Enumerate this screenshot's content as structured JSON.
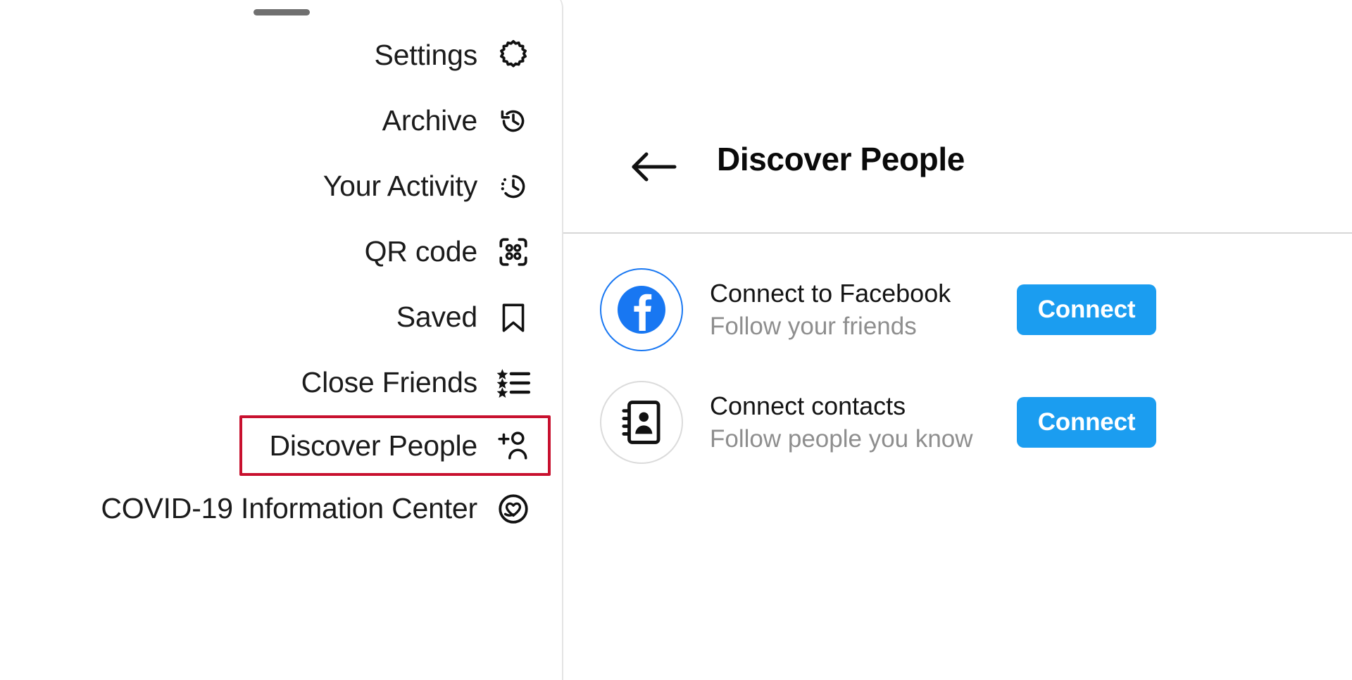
{
  "sheet": {
    "drag_handle": "drag-handle",
    "menu_items": [
      {
        "label": "Settings",
        "icon": "gear-icon",
        "highlighted": false
      },
      {
        "label": "Archive",
        "icon": "archive-clock-icon",
        "highlighted": false
      },
      {
        "label": "Your Activity",
        "icon": "activity-clock-icon",
        "highlighted": false
      },
      {
        "label": "QR code",
        "icon": "qr-code-icon",
        "highlighted": false
      },
      {
        "label": "Saved",
        "icon": "bookmark-icon",
        "highlighted": false
      },
      {
        "label": "Close Friends",
        "icon": "star-list-icon",
        "highlighted": false
      },
      {
        "label": "Discover People",
        "icon": "add-person-icon",
        "highlighted": true
      },
      {
        "label": "COVID-19 Information Center",
        "icon": "covid-heart-icon",
        "highlighted": false
      }
    ]
  },
  "detail": {
    "back_icon": "back-arrow-icon",
    "title": "Discover People",
    "rows": [
      {
        "icon": "facebook-icon",
        "title": "Connect to Facebook",
        "subtitle": "Follow your friends",
        "button_label": "Connect"
      },
      {
        "icon": "contacts-book-icon",
        "title": "Connect contacts",
        "subtitle": "Follow people you know",
        "button_label": "Connect"
      }
    ]
  },
  "colors": {
    "highlight_border": "#C8102E",
    "facebook_blue": "#1877F2",
    "button_blue": "#1B9DF0",
    "subtitle_gray": "#8e8e8e",
    "divider_gray": "#d6d6d6"
  }
}
